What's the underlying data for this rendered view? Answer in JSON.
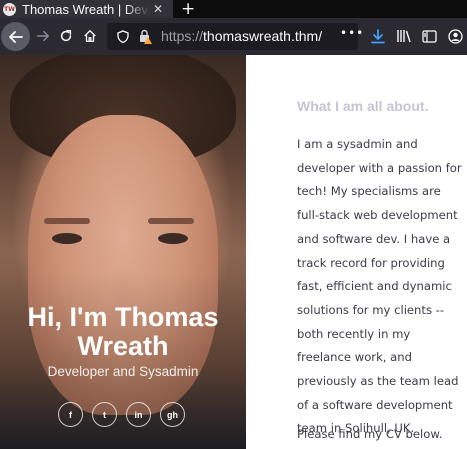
{
  "browser": {
    "tab": {
      "title": "Thomas Wreath | Developer",
      "favicon_text": "TW",
      "close_icon": "close-icon"
    },
    "new_tab_icon": "plus-icon",
    "nav": {
      "back_icon": "arrow-left-icon",
      "forward_icon": "arrow-right-icon",
      "reload_icon": "reload-icon",
      "home_icon": "home-icon"
    },
    "url": {
      "protocol": "https://",
      "host": "thomaswreath.thm/",
      "menu_dots": "•••"
    },
    "toolbar_icons": [
      "download-icon",
      "library-icon",
      "sidebar-icon",
      "account-icon"
    ],
    "accent": "#45a1ff"
  },
  "hero": {
    "name": "Hi, I'm Thomas Wreath",
    "subtitle": "Developer and Sysadmin",
    "socials": [
      {
        "icon": "facebook-icon",
        "glyph": "f"
      },
      {
        "icon": "twitter-icon",
        "glyph": "t"
      },
      {
        "icon": "linkedin-icon",
        "glyph": "in"
      },
      {
        "icon": "github-icon",
        "glyph": "gh"
      }
    ]
  },
  "about": {
    "heading": "What I am all about.",
    "lines": [
      "I am a sysadmin and",
      "developer with a passion for",
      "tech! My specialisms are",
      "full-stack web development",
      "and software dev. I have a",
      "track record for providing",
      "fast, efficient and dynamic",
      "solutions for my clients --",
      "both recently in my",
      "freelance work, and",
      "previously as the team lead",
      "of a software development",
      "team in Solihull, UK."
    ],
    "cv_text": "Please find my CV below.",
    "heading_color": "#c8c4d6"
  }
}
